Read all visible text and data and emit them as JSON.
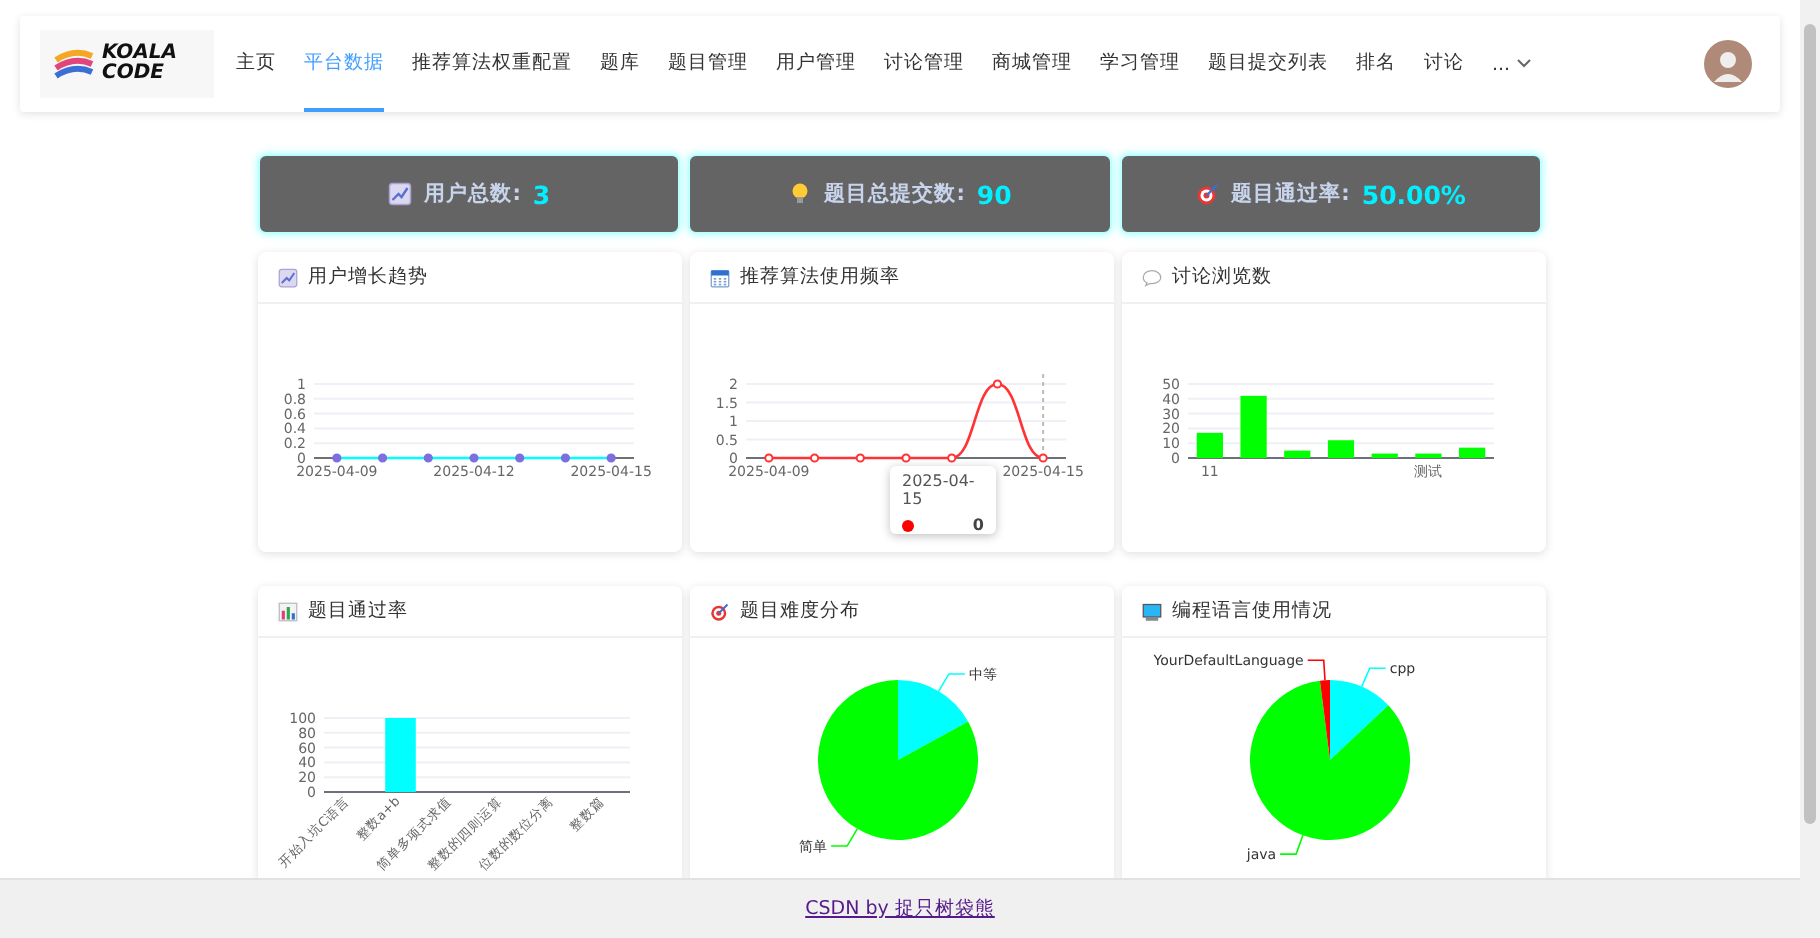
{
  "header": {
    "logo": {
      "line1": "KOALA",
      "line2": "CODE"
    },
    "nav": [
      {
        "label": "主页",
        "selected": false
      },
      {
        "label": "平台数据",
        "selected": true
      },
      {
        "label": "推荐算法权重配置",
        "selected": false
      },
      {
        "label": "题库",
        "selected": false
      },
      {
        "label": "题目管理",
        "selected": false
      },
      {
        "label": "用户管理",
        "selected": false
      },
      {
        "label": "讨论管理",
        "selected": false
      },
      {
        "label": "商城管理",
        "selected": false
      },
      {
        "label": "学习管理",
        "selected": false
      },
      {
        "label": "题目提交列表",
        "selected": false
      },
      {
        "label": "排名",
        "selected": false
      },
      {
        "label": "讨论",
        "selected": false
      }
    ],
    "more": {
      "label": "..."
    }
  },
  "stats": [
    {
      "label": "用户总数:",
      "value": "3"
    },
    {
      "label": "题目总提交数:",
      "value": "90"
    },
    {
      "label": "题目通过率:",
      "value": "50.00%"
    }
  ],
  "charts": [
    {
      "title": "用户增长趋势",
      "chart_data": {
        "type": "line",
        "categories": [
          "2025-04-09",
          null,
          null,
          "2025-04-12",
          null,
          null,
          "2025-04-15"
        ],
        "ylim": [
          0,
          1
        ],
        "yticks": [
          0,
          0.2,
          0.4,
          0.6,
          0.8,
          1
        ],
        "grid": true,
        "series": [
          {
            "color": "#00ffff",
            "marker": "circle",
            "values": [
              0,
              0,
              0,
              0,
              0,
              0,
              0
            ]
          }
        ]
      }
    },
    {
      "title": "推荐算法使用频率",
      "chart_data": {
        "type": "line",
        "categories": [
          "2025-04-09",
          null,
          null,
          null,
          null,
          null,
          "2025-04-15"
        ],
        "ylim": [
          0,
          2
        ],
        "yticks": [
          0,
          0.5,
          1,
          1.5,
          2
        ],
        "grid": true,
        "series": [
          {
            "color": "#ff3333",
            "marker": "circle",
            "values": [
              0,
              0,
              0,
              0,
              0,
              2,
              0
            ]
          }
        ]
      },
      "tooltip": {
        "title": "2025-04-15",
        "value": "0"
      }
    },
    {
      "title": "讨论浏览数",
      "chart_data": {
        "type": "bar",
        "categories": [
          "11",
          null,
          null,
          null,
          null,
          "测试",
          null
        ],
        "ylim": [
          0,
          50
        ],
        "yticks": [
          0,
          10,
          20,
          30,
          40,
          50
        ],
        "grid": true,
        "series": [
          {
            "color": "#00ff00",
            "values": [
              17,
              42,
              5,
              12,
              3,
              3,
              7
            ]
          }
        ]
      }
    },
    {
      "title": "题目通过率",
      "chart_data": {
        "type": "bar",
        "categories": [
          "开始入坑C语言",
          "整数a+b",
          "简单多项式求值",
          "整数的四则运算",
          "位数的数位分离",
          "整数篇"
        ],
        "ylim": [
          0,
          100
        ],
        "yticks": [
          0,
          20,
          40,
          60,
          80,
          100
        ],
        "grid": true,
        "series": [
          {
            "color": "#00ffff",
            "values": [
              0,
              100,
              0,
              0,
              0,
              0
            ]
          }
        ]
      }
    },
    {
      "title": "题目难度分布",
      "chart_data": {
        "type": "pie",
        "categories": [
          "中等",
          "简单"
        ],
        "values": [
          17,
          83
        ],
        "colors": [
          "#00ffff",
          "#00ff00"
        ]
      }
    },
    {
      "title": "编程语言使用情况",
      "chart_data": {
        "type": "pie",
        "categories": [
          "cpp",
          "java",
          "YourDefaultLanguage"
        ],
        "values": [
          13,
          85,
          2
        ],
        "colors": [
          "#00ffff",
          "#00ff00",
          "#ff0000"
        ]
      }
    }
  ],
  "footer": {
    "link": "CSDN by 捉只树袋熊"
  }
}
